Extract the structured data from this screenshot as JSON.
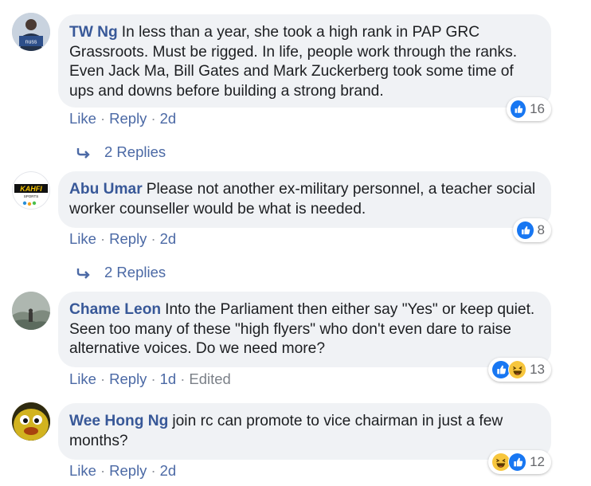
{
  "comments": [
    {
      "author": "TW Ng",
      "text": "In less than a year, she took a high rank in PAP GRC Grassroots. Must be rigged. In life, people work through the ranks. Even Jack Ma, Bill Gates and Mark Zuckerberg took some time of ups and downs before building a strong brand.",
      "avatar_logo_text": "nuss",
      "like_label": "Like",
      "reply_label": "Reply",
      "time": "2d",
      "reaction_count": "16",
      "reaction_icons": [
        "like-icon"
      ],
      "replies_label": "2 Replies"
    },
    {
      "author": "Abu Umar",
      "text": "Please not another ex-military personnel, a teacher social worker counseller would be what is needed.",
      "avatar_logo_text": "KAHFI",
      "avatar_logo_subtext": "SPORTS",
      "like_label": "Like",
      "reply_label": "Reply",
      "time": "2d",
      "reaction_count": "8",
      "reaction_icons": [
        "like-icon"
      ],
      "replies_label": "2 Replies"
    },
    {
      "author": "Chame Leon",
      "text": "Into the Parliament then either say \"Yes\" or keep quiet. Seen too many of these \"high flyers\" who don't even dare to raise alternative voices. Do we need more?",
      "like_label": "Like",
      "reply_label": "Reply",
      "time": "1d",
      "edited_label": "Edited",
      "reaction_count": "13",
      "reaction_icons": [
        "like-icon",
        "haha-icon"
      ]
    },
    {
      "author": "Wee Hong Ng",
      "text": "join rc can promote to vice chairman in just a few months?",
      "like_label": "Like",
      "reply_label": "Reply",
      "time": "2d",
      "reaction_count": "12",
      "reaction_icons": [
        "haha-icon",
        "like-icon"
      ]
    }
  ],
  "colors": {
    "bubble_bg": "#f0f2f5",
    "author": "#385898",
    "link": "#4b69a5",
    "like_blue": "#1877f2",
    "haha_yellow": "#f7c63d"
  }
}
